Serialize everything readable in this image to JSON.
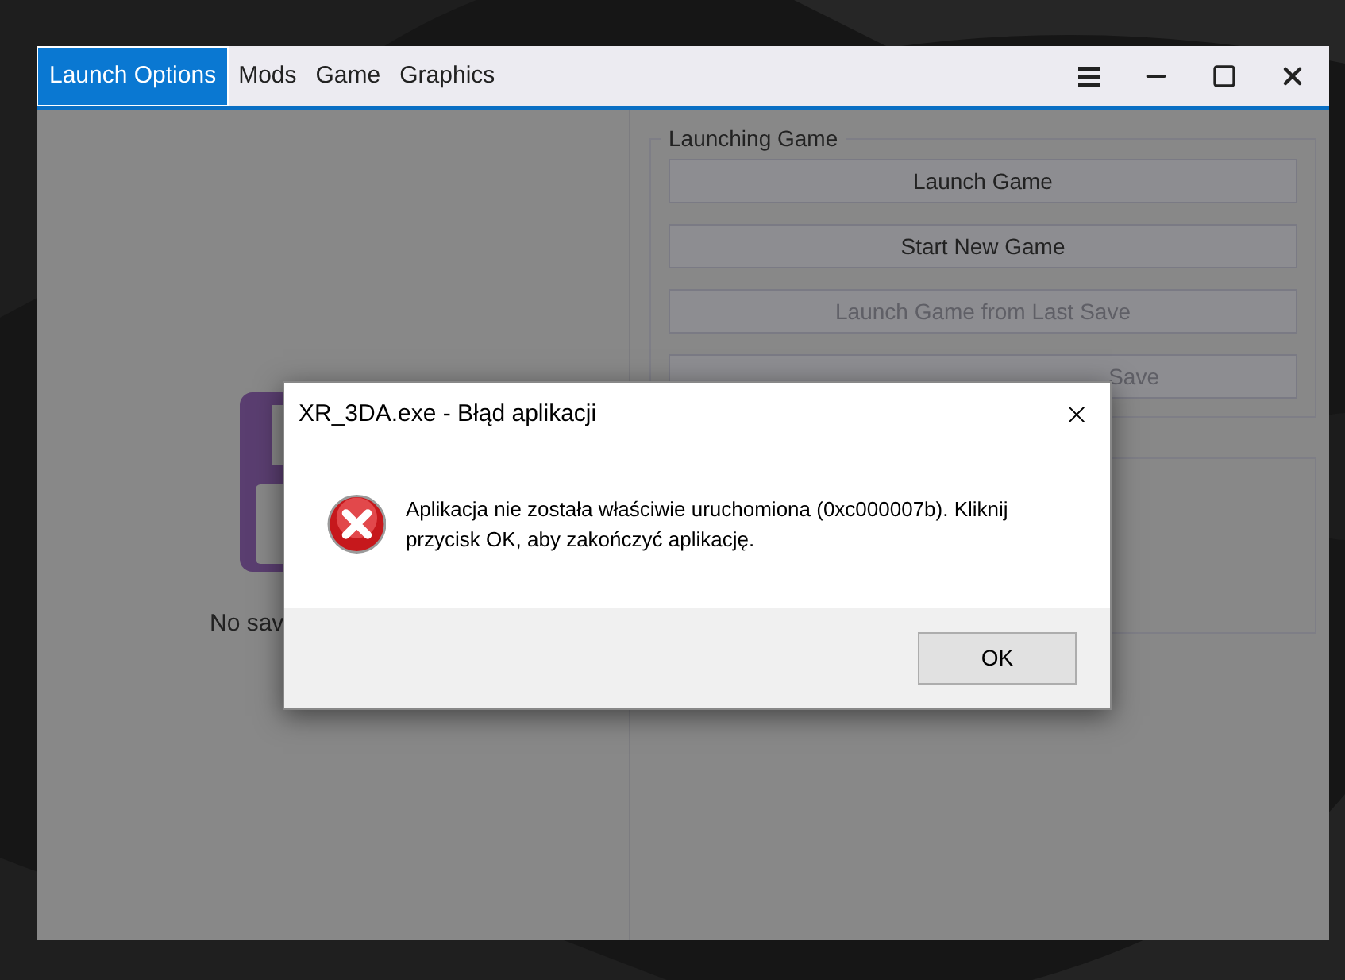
{
  "window": {
    "tabs": [
      {
        "label": "Launch Options",
        "selected": true
      },
      {
        "label": "Mods",
        "selected": false
      },
      {
        "label": "Game",
        "selected": false
      },
      {
        "label": "Graphics",
        "selected": false
      }
    ]
  },
  "saves_panel": {
    "message": "No sav"
  },
  "launching_group": {
    "title": "Launching Game",
    "buttons": [
      {
        "label": "Launch Game",
        "disabled": false
      },
      {
        "label": "Start New Game",
        "disabled": false
      },
      {
        "label": "Launch Game from Last Save",
        "disabled": true
      },
      {
        "label": "Save",
        "disabled": true,
        "cut": true
      }
    ]
  },
  "dialog": {
    "title": "XR_3DA.exe - Błąd aplikacji",
    "message": "Aplikacja nie została właściwie uruchomiona (0xc000007b). Kliknij przycisk OK, aby zakończyć aplikację.",
    "button": "OK"
  }
}
